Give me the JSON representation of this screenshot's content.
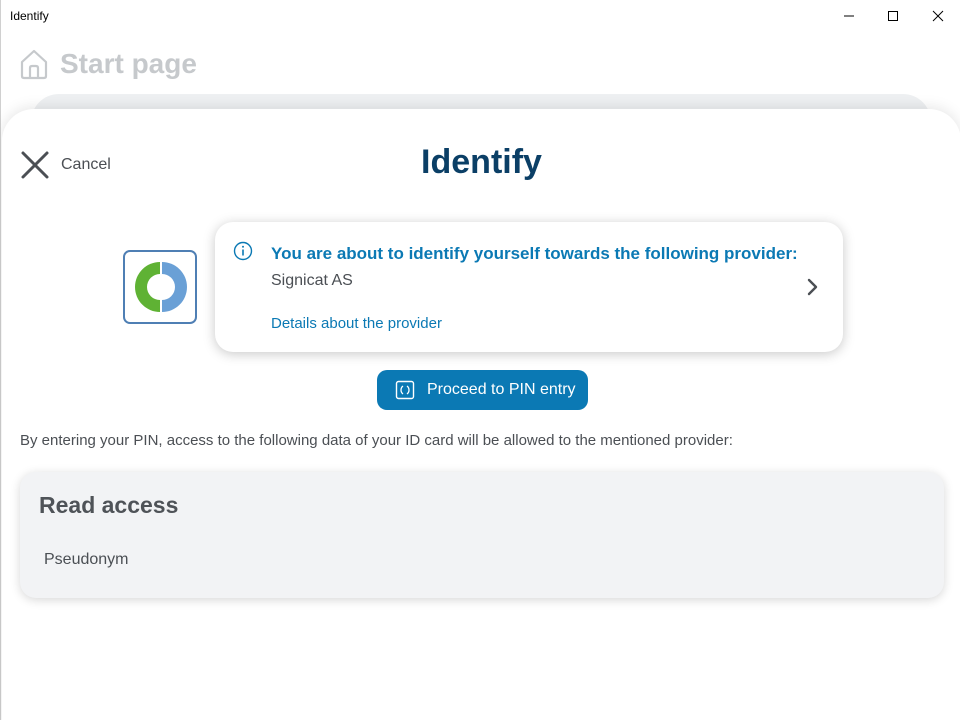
{
  "window": {
    "title": "Identify"
  },
  "start_page": {
    "title": "Start page",
    "icon": "home-icon"
  },
  "dialog": {
    "cancel_label": "Cancel",
    "title": "Identify",
    "provider_card": {
      "headline": "You are about to identify yourself towards the following provider:",
      "provider_name": "Signicat AS",
      "details_link": "Details about the provider"
    },
    "proceed_button_label": "Proceed to PIN entry",
    "access_description": "By entering your PIN, access to the following data of your ID card will be allowed to the mentioned provider:",
    "read_access": {
      "title": "Read access",
      "items": [
        "Pseudonym"
      ]
    }
  },
  "colors": {
    "brand_dark": "#0b3f66",
    "accent": "#0b79b4",
    "text": "#4b4f54",
    "logo_green": "#5fb234",
    "logo_blue": "#6aa0d6"
  }
}
